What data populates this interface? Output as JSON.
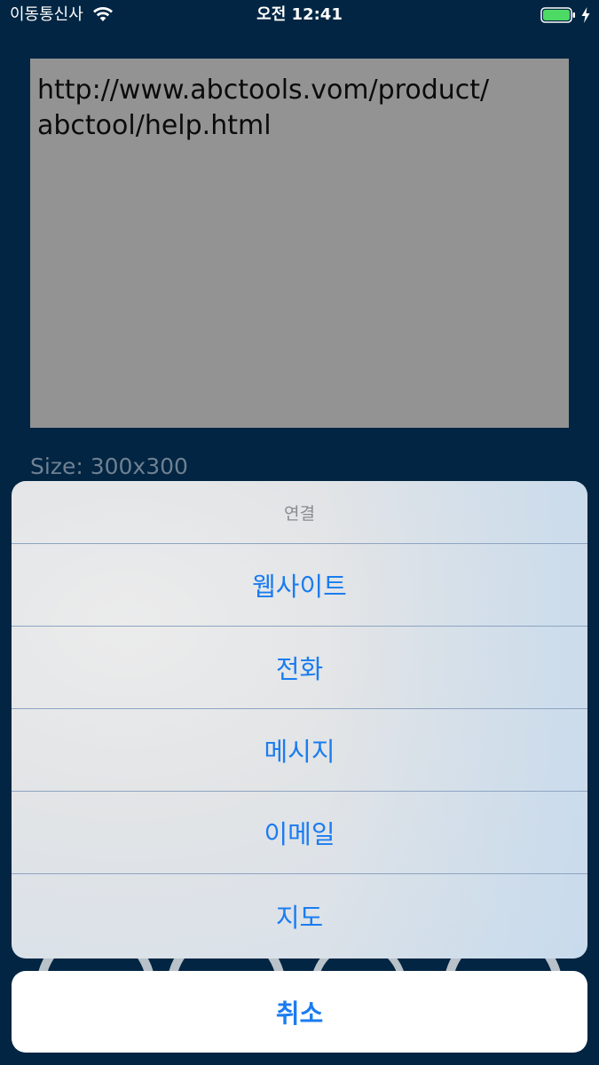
{
  "status_bar": {
    "carrier": "이동통신사",
    "time": "오전 12:41",
    "icons": [
      "wifi-icon",
      "battery-icon",
      "charging-icon"
    ]
  },
  "content": {
    "text_lines": [
      "http://www.abctools.vom/product/",
      "abctool/help.html"
    ],
    "size_label": "Size: 300x300"
  },
  "action_sheet": {
    "title": "연결",
    "items": [
      "웹사이트",
      "전화",
      "메시지",
      "이메일",
      "지도"
    ],
    "cancel": "취소"
  },
  "colors": {
    "background": "#012542",
    "text_box": "#939393",
    "accent": "#1a7cf0",
    "battery": "#4cd964"
  }
}
